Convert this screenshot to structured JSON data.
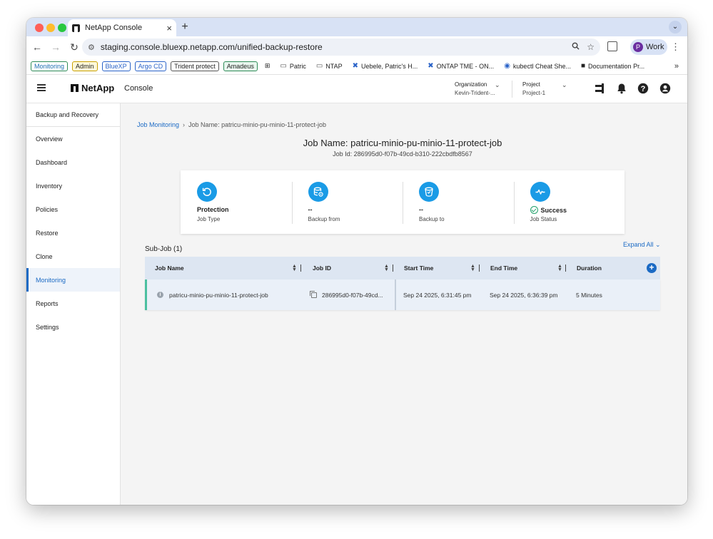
{
  "browser": {
    "tab_title": "NetApp Console",
    "url": "staging.console.bluexp.netapp.com/unified-backup-restore",
    "profile_label": "Work",
    "profile_initial": "P",
    "bookmarks": [
      "Monitoring",
      "Admin",
      "BlueXP",
      "Argo CD",
      "Trident protect",
      "Amadeus",
      "Patric",
      "NTAP",
      "Uebele, Patric's H...",
      "ONTAP TME - ON...",
      "kubectl Cheat She...",
      "Documentation Pr..."
    ]
  },
  "app": {
    "brand": "NetApp",
    "product": "Console",
    "organization_label": "Organization",
    "organization_value": "Kevin-Trident-...",
    "project_label": "Project",
    "project_value": "Project-1"
  },
  "sidebar": {
    "title": "Backup and Recovery",
    "items": [
      "Overview",
      "Dashboard",
      "Inventory",
      "Policies",
      "Restore",
      "Clone",
      "Monitoring",
      "Reports",
      "Settings"
    ],
    "active": "Monitoring"
  },
  "breadcrumb": {
    "root": "Job Monitoring",
    "current": "Job Name: patricu-minio-pu-minio-11-protect-job"
  },
  "job": {
    "title": "Job Name: patricu-minio-pu-minio-11-protect-job",
    "id_line": "Job Id: 286995d0-f07b-49cd-b310-222cbdfb8567",
    "summary": [
      {
        "value": "Protection",
        "label": "Job Type"
      },
      {
        "value": "--",
        "label": "Backup from"
      },
      {
        "value": "--",
        "label": "Backup to"
      },
      {
        "value": "Success",
        "label": "Job Status"
      }
    ]
  },
  "subjobs": {
    "title": "Sub-Job (1)",
    "expand_label": "Expand All",
    "columns": [
      "Job Name",
      "Job ID",
      "Start Time",
      "End Time",
      "Duration"
    ],
    "rows": [
      {
        "name": "patricu-minio-pu-minio-11-protect-job",
        "id": "286995d0-f07b-49cd...",
        "start": "Sep 24 2025, 6:31:45 pm",
        "end": "Sep 24 2025, 6:36:39 pm",
        "duration": "5 Minutes"
      }
    ]
  },
  "colors": {
    "accent": "#1b6ac4",
    "icon_circle": "#1a9be6",
    "success": "#22a06b"
  }
}
